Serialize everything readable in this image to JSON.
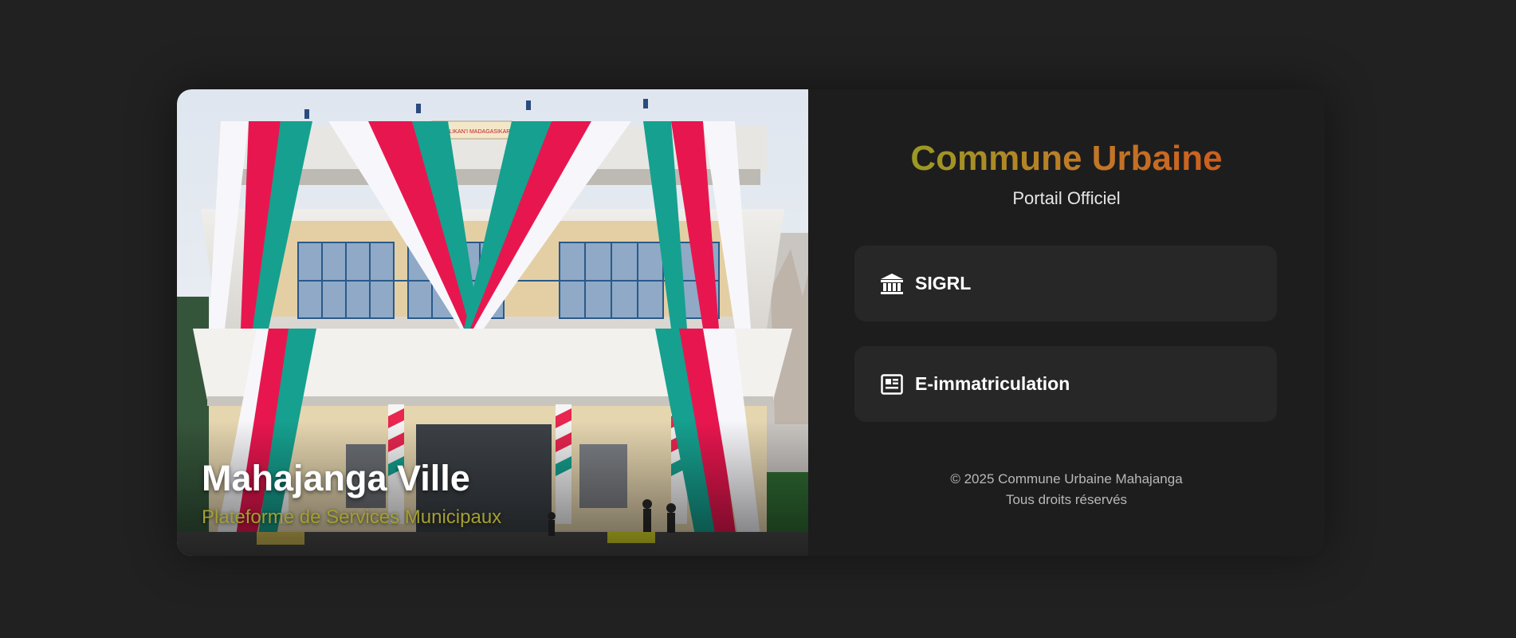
{
  "hero": {
    "title": "Mahajanga Ville",
    "subtitle": "Plateforme de Services Municipaux",
    "building_sign": "REPOBLIKAN'I MADAGASIKARA",
    "image_alt": "Hôtel de ville de Mahajanga"
  },
  "brand": {
    "title": "Commune Urbaine",
    "subtitle": "Portail Officiel"
  },
  "services": [
    {
      "label": "SIGRL",
      "icon": "building-columns-icon"
    },
    {
      "label": "E-immatriculation",
      "icon": "id-card-icon"
    }
  ],
  "footer": {
    "copyright": "© 2025 Commune Urbaine Mahajanga",
    "rights": "Tous droits réservés"
  },
  "colors": {
    "background": "#212121",
    "card": "#1d1d1d",
    "service_button": "#272727",
    "title_gradient_start": "#9a9a24",
    "title_gradient_end": "#cc5e1e",
    "hero_subtitle": "#a3a030"
  }
}
